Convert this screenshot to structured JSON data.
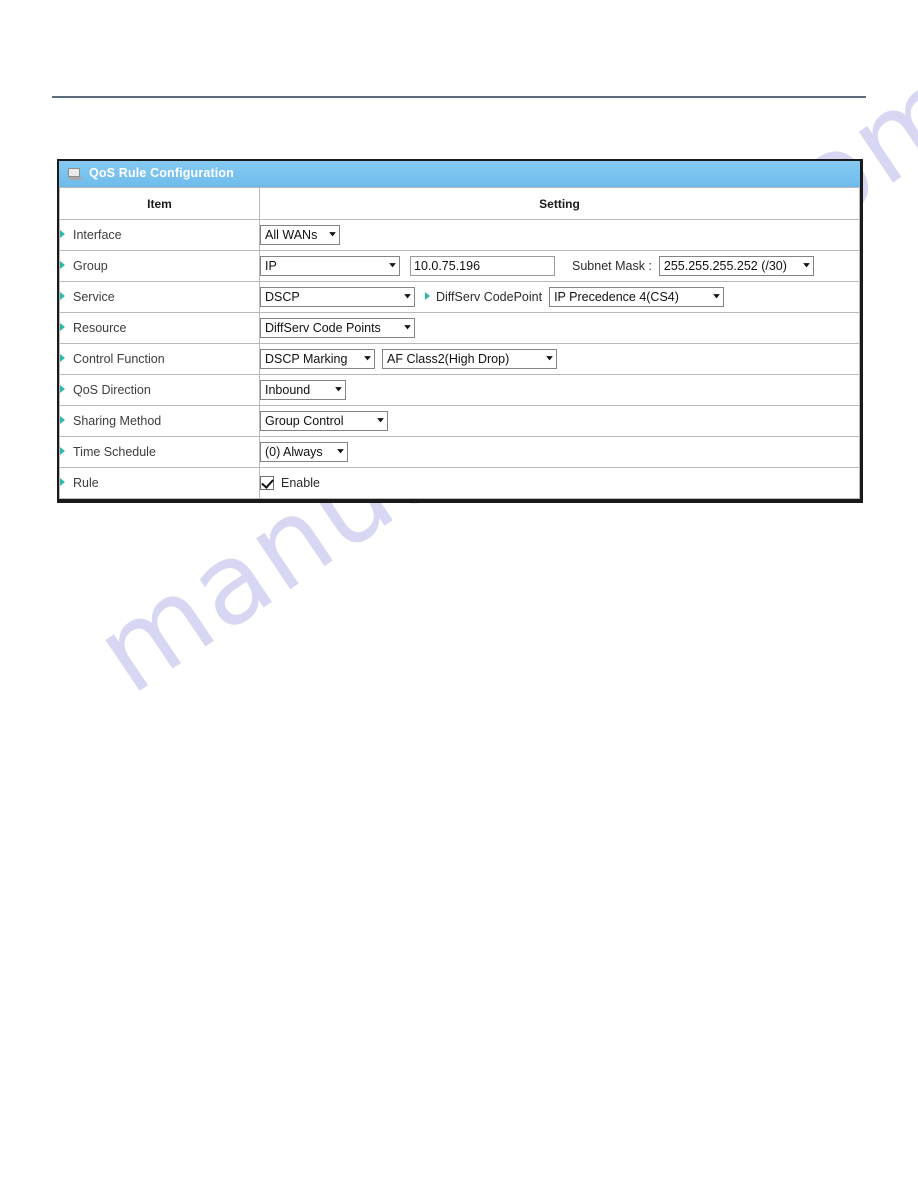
{
  "watermark": {
    "text": "manualshive.com",
    "color": "#c8c8ef"
  },
  "panel": {
    "title": "QoS Rule Configuration",
    "title_icon": "monitor-icon",
    "accent_color": "#79c2ef",
    "bullet_color": "#2fb8a8",
    "columns": {
      "item": "Item",
      "setting": "Setting"
    },
    "rows": [
      {
        "label": "Interface",
        "controls": [
          {
            "kind": "select",
            "name": "interface-select",
            "value": "All WANs"
          }
        ]
      },
      {
        "label": "Group",
        "controls": [
          {
            "kind": "select",
            "name": "group-type-select",
            "value": "IP"
          },
          {
            "kind": "text",
            "name": "group-ip-input",
            "value": "10.0.75.196"
          },
          {
            "kind": "label",
            "name": "subnet-mask-label",
            "value": "Subnet Mask :"
          },
          {
            "kind": "select",
            "name": "subnet-mask-select",
            "value": "255.255.255.252 (/30)"
          }
        ]
      },
      {
        "label": "Service",
        "controls": [
          {
            "kind": "select",
            "name": "service-select",
            "value": "DSCP"
          },
          {
            "kind": "bullet-label",
            "name": "diffserv-codepoint-label",
            "value": "DiffServ CodePoint"
          },
          {
            "kind": "select",
            "name": "diffserv-codepoint-select",
            "value": "IP Precedence 4(CS4)"
          }
        ]
      },
      {
        "label": "Resource",
        "controls": [
          {
            "kind": "select",
            "name": "resource-select",
            "value": "DiffServ Code Points"
          }
        ]
      },
      {
        "label": "Control Function",
        "controls": [
          {
            "kind": "select",
            "name": "control-function-select",
            "value": "DSCP Marking"
          },
          {
            "kind": "select",
            "name": "dscp-class-select",
            "value": "AF Class2(High Drop)"
          }
        ]
      },
      {
        "label": "QoS Direction",
        "controls": [
          {
            "kind": "select",
            "name": "qos-direction-select",
            "value": "Inbound"
          }
        ]
      },
      {
        "label": "Sharing Method",
        "controls": [
          {
            "kind": "select",
            "name": "sharing-method-select",
            "value": "Group Control"
          }
        ]
      },
      {
        "label": "Time Schedule",
        "controls": [
          {
            "kind": "select",
            "name": "time-schedule-select",
            "value": "(0) Always"
          }
        ]
      },
      {
        "label": "Rule",
        "controls": [
          {
            "kind": "checkbox",
            "name": "rule-enable-checkbox",
            "value": "Enable",
            "checked": true
          }
        ]
      }
    ]
  }
}
